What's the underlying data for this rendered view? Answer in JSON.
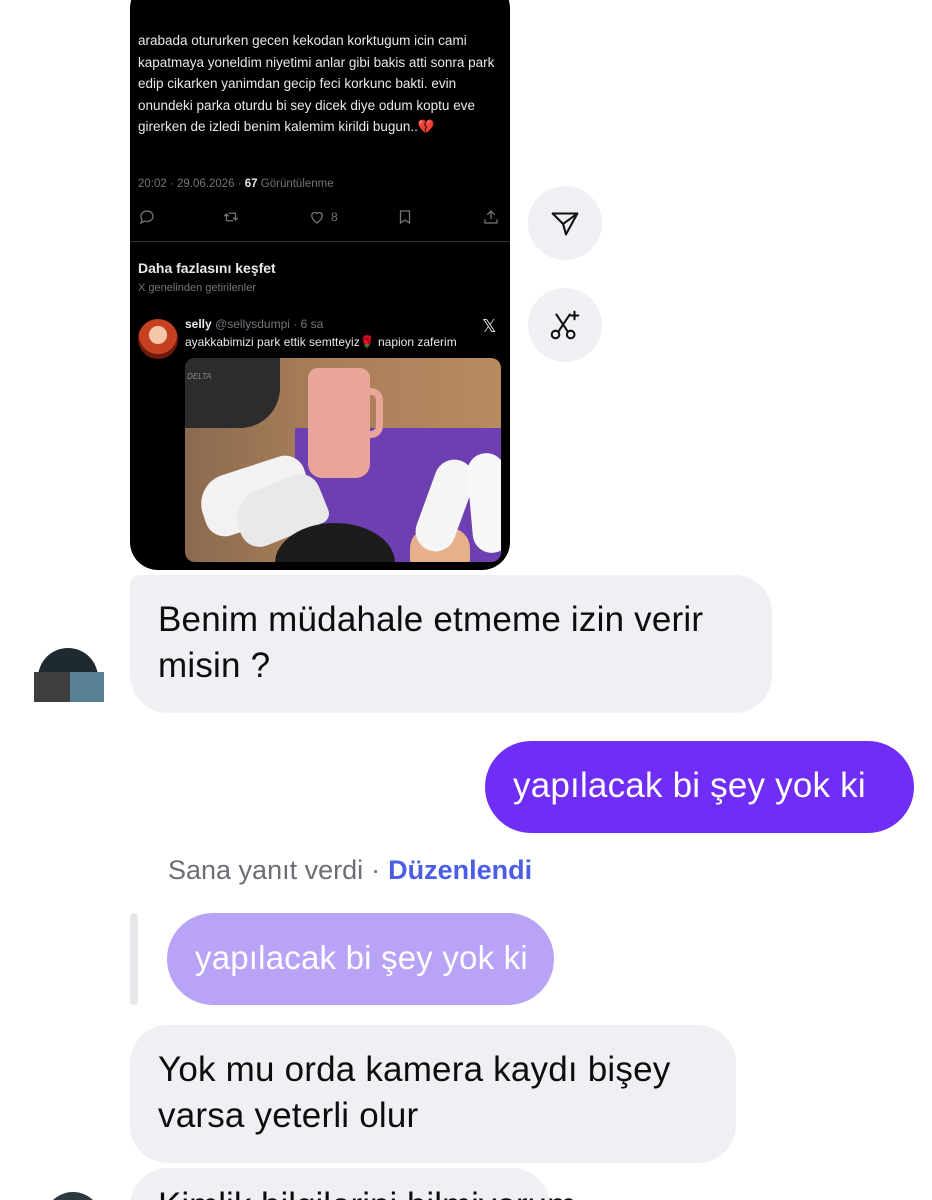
{
  "shared_tweet": {
    "text": "arabada otururken gecen kekodan korktugum icin cami kapatmaya yoneldim niyetimi anlar gibi bakis atti sonra park edip cikarken yanimdan gecip feci korkunc bakti. evin onundeki parka oturdu bi sey dicek diye odum koptu eve girerken de izledi benim kalemim kirildi bugun..💔",
    "time": "20:02 · 29.06.2026 · ",
    "views_count": "67",
    "views_label": " Görüntülenme",
    "like_count": "8",
    "discover_title": "Daha fazlasını keşfet",
    "discover_subtitle": "X genelinden getirilenler",
    "suggested": {
      "name": "selly",
      "handle_time": " @sellysdumpi · 6 sa",
      "text": "ayakkabimizi park ettik semtteyiz🌹 napion zaferim",
      "photo_mat_text": "DELTA"
    }
  },
  "messages": {
    "incoming_1": "Benim müdahale etmeme izin verir misin ?",
    "outgoing_1": "yapılacak bi şey yok ki",
    "reply_meta_prefix": "Sana yanıt verdi",
    "reply_meta_dot": "·",
    "reply_meta_edited": "Düzenlendi",
    "quoted": "yapılacak bi şey yok ki",
    "incoming_2": "Yok mu orda kamera kaydı bişey varsa yeterli olur",
    "incoming_3_partial": "Kimlik bilgilerini bilmiyorum"
  },
  "icons": {
    "share": "send-icon",
    "clip": "scissors-sparkle-icon"
  }
}
